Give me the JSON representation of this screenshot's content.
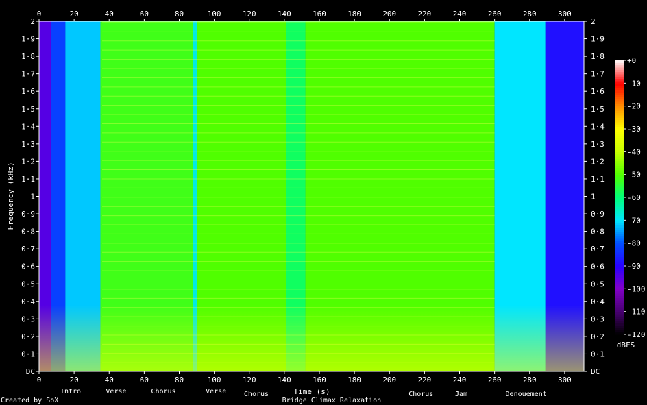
{
  "chart_data": {
    "type": "heatmap",
    "credit": "Created by SoX",
    "xlabel": "Time (s)",
    "ylabel": "Frequency (kHz)",
    "colorbar_label": "dBFS",
    "x_ticks": [
      0,
      20,
      40,
      60,
      80,
      100,
      120,
      140,
      160,
      180,
      200,
      220,
      240,
      260,
      280,
      300
    ],
    "xlim": [
      0,
      311
    ],
    "y_ticks": [
      {
        "v": 0,
        "label": "DC"
      },
      {
        "v": 0.1,
        "label": "0·1"
      },
      {
        "v": 0.2,
        "label": "0·2"
      },
      {
        "v": 0.3,
        "label": "0·3"
      },
      {
        "v": 0.4,
        "label": "0·4"
      },
      {
        "v": 0.5,
        "label": "0·5"
      },
      {
        "v": 0.6,
        "label": "0·6"
      },
      {
        "v": 0.7,
        "label": "0·7"
      },
      {
        "v": 0.8,
        "label": "0·8"
      },
      {
        "v": 0.9,
        "label": "0·9"
      },
      {
        "v": 1.0,
        "label": "1"
      },
      {
        "v": 1.1,
        "label": "1·1"
      },
      {
        "v": 1.2,
        "label": "1·2"
      },
      {
        "v": 1.3,
        "label": "1·3"
      },
      {
        "v": 1.4,
        "label": "1·4"
      },
      {
        "v": 1.5,
        "label": "1·5"
      },
      {
        "v": 1.6,
        "label": "1·6"
      },
      {
        "v": 1.7,
        "label": "1·7"
      },
      {
        "v": 1.8,
        "label": "1·8"
      },
      {
        "v": 1.9,
        "label": "1·9"
      },
      {
        "v": 2.0,
        "label": "2"
      }
    ],
    "ylim": [
      0,
      2
    ],
    "colorbar": {
      "range": [
        -120,
        0
      ],
      "ticks": [
        {
          "v": 0,
          "label": "+0"
        },
        {
          "v": -10,
          "label": "-10"
        },
        {
          "v": -20,
          "label": "-20"
        },
        {
          "v": -30,
          "label": "-30"
        },
        {
          "v": -40,
          "label": "-40"
        },
        {
          "v": -50,
          "label": "-50"
        },
        {
          "v": -60,
          "label": "-60"
        },
        {
          "v": -70,
          "label": "-70"
        },
        {
          "v": -80,
          "label": "-80"
        },
        {
          "v": -90,
          "label": "-90"
        },
        {
          "v": -100,
          "label": "-100"
        },
        {
          "v": -110,
          "label": "-110"
        },
        {
          "v": -120,
          "label": "-120"
        }
      ]
    },
    "sections": [
      {
        "label": "Intro",
        "t": 18,
        "row": 1
      },
      {
        "label": "Verse",
        "t": 44,
        "row": 1
      },
      {
        "label": "Chorus",
        "t": 71,
        "row": 1
      },
      {
        "label": "Verse",
        "t": 101,
        "row": 1
      },
      {
        "label": "Chorus",
        "t": 124,
        "row": 2
      },
      {
        "label": "Bridge Climax Relaxation",
        "t": 167,
        "row": 3
      },
      {
        "label": "Chorus",
        "t": 218,
        "row": 2
      },
      {
        "label": "Jam",
        "t": 241,
        "row": 2
      },
      {
        "label": "Denouement",
        "t": 278,
        "row": 2
      }
    ],
    "energy_segments": [
      {
        "t0": 0,
        "t1": 7,
        "level": -95
      },
      {
        "t0": 7,
        "t1": 15,
        "level": -82
      },
      {
        "t0": 15,
        "t1": 35,
        "level": -72
      },
      {
        "t0": 35,
        "t1": 88,
        "level": -52
      },
      {
        "t0": 88,
        "t1": 90,
        "level": -68
      },
      {
        "t0": 90,
        "t1": 141,
        "level": -50
      },
      {
        "t0": 141,
        "t1": 152,
        "level": -58
      },
      {
        "t0": 152,
        "t1": 260,
        "level": -50
      },
      {
        "t0": 260,
        "t1": 289,
        "level": -70
      },
      {
        "t0": 289,
        "t1": 311,
        "level": -88
      }
    ]
  }
}
